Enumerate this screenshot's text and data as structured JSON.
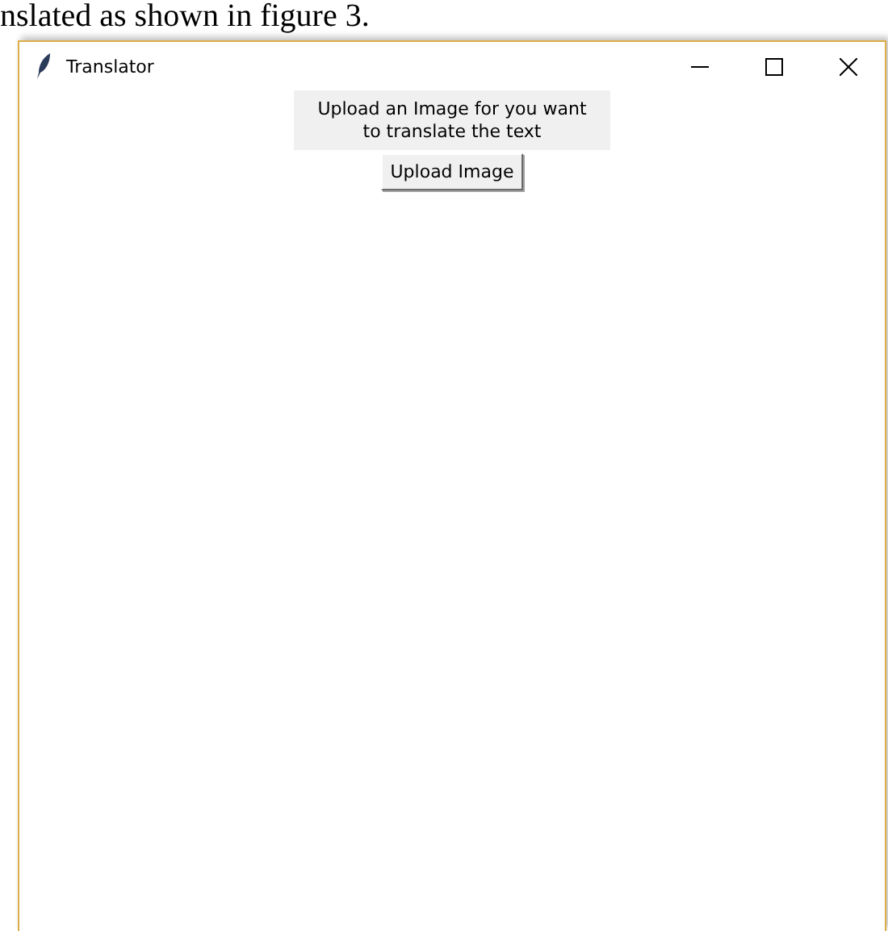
{
  "caption": "nslated as shown in figure 3.",
  "window": {
    "title": "Translator"
  },
  "prompt": "Upload an Image for you want to translate the text",
  "buttons": [
    {
      "kind": "upload",
      "label": "Upload Image"
    }
  ]
}
